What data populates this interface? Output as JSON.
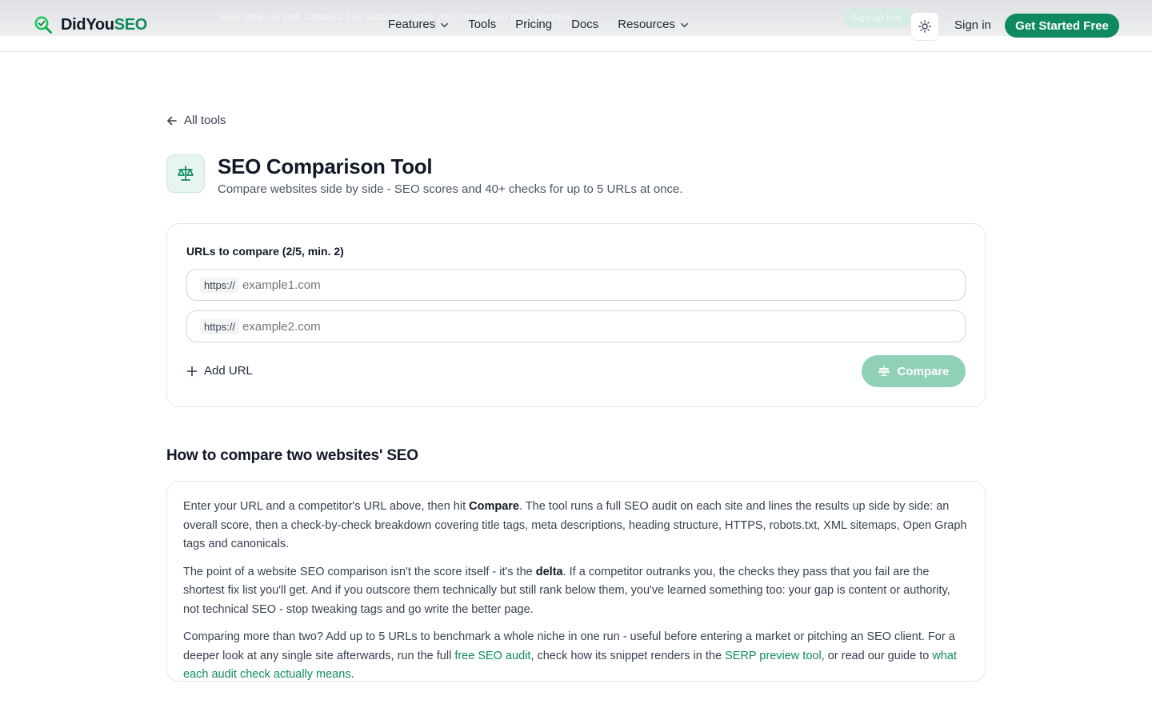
{
  "banner": {
    "text": "Free tools, no limit. Create a free account to save your reports and track progress.",
    "button": "Sign up free"
  },
  "header": {
    "logo_part1": "DidYou",
    "logo_part2": "SEO",
    "nav": [
      {
        "label": "Features",
        "dropdown": true
      },
      {
        "label": "Tools",
        "dropdown": false
      },
      {
        "label": "Pricing",
        "dropdown": false
      },
      {
        "label": "Docs",
        "dropdown": false
      },
      {
        "label": "Resources",
        "dropdown": true
      }
    ],
    "sign_in": "Sign in",
    "cta": "Get Started Free"
  },
  "page": {
    "back_link": "All tools",
    "title": "SEO Comparison Tool",
    "subtitle": "Compare websites side by side - SEO scores and 40+ checks for up to 5 URLs at once."
  },
  "form": {
    "label": "URLs to compare (2/5, min. 2)",
    "fields": [
      {
        "prefix": "https://",
        "placeholder": "example1.com"
      },
      {
        "prefix": "https://",
        "placeholder": "example2.com"
      }
    ],
    "add_url": "Add URL",
    "compare": "Compare"
  },
  "howto": {
    "heading": "How to compare two websites' SEO",
    "p1_a": "Enter your URL and a competitor's URL above, then hit ",
    "p1_b": "Compare",
    "p1_c": ". The tool runs a full SEO audit on each site and lines the results up side by side: an overall score, then a check-by-check breakdown covering title tags, meta descriptions, heading structure, HTTPS, robots.txt, XML sitemaps, Open Graph tags and canonicals.",
    "p2_a": "The point of a website SEO comparison isn't the score itself - it's the ",
    "p2_b": "delta",
    "p2_c": ". If a competitor outranks you, the checks they pass that you fail are the shortest fix list you'll get. And if you outscore them technically but still rank below them, you've learned something too: your gap is content or authority, not technical SEO - stop tweaking tags and go write the better page.",
    "p3_a": "Comparing more than two? Add up to 5 URLs to benchmark a whole niche in one run - useful before entering a market or pitching an SEO client. For a deeper look at any single site afterwards, run the full ",
    "p3_link1": "free SEO audit",
    "p3_b": ", check how its snippet renders in the ",
    "p3_link2": "SERP preview tool",
    "p3_c": ", or read our guide to ",
    "p3_link3": "what each audit check actually means",
    "p3_d": "."
  },
  "colors": {
    "brand": "#0f8a5f",
    "brand_disabled": "#8fd0b6",
    "logo_icon": "#22c55e"
  },
  "icons": {
    "logo": "magnifier-check-icon",
    "theme": "sun-icon",
    "back": "arrow-left-icon",
    "tool": "scale-icon",
    "add": "plus-icon",
    "compare": "scale-icon"
  }
}
